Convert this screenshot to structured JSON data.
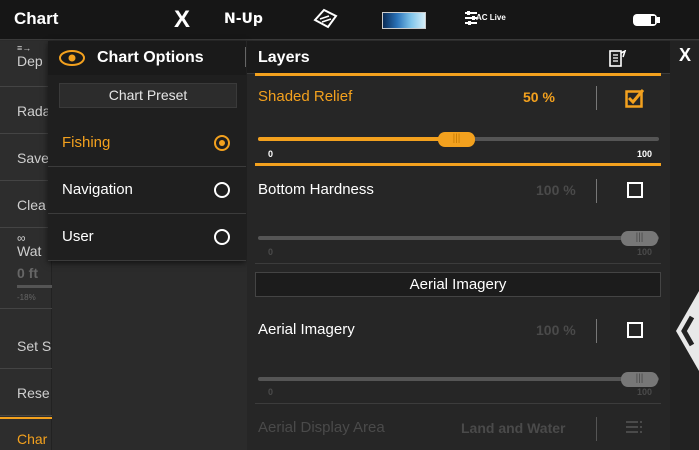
{
  "topbar": {
    "title": "Chart",
    "close_symbol": "X",
    "view_label": "N-Up",
    "aclive_label": "AC Live",
    "icons": [
      "close-icon",
      "sonar-fish-icon",
      "palette-gradient-icon",
      "ac-live-icon",
      "battery-icon"
    ]
  },
  "left_menu": {
    "items": [
      "Dep",
      "Rada",
      "Save",
      "Clea",
      "Wat",
      "0 ft",
      "-18%",
      "Set S",
      "Rese",
      "Char"
    ]
  },
  "chart_options": {
    "title": "Chart Options",
    "preset_label": "Chart Preset",
    "presets": [
      {
        "label": "Fishing",
        "selected": true
      },
      {
        "label": "Navigation",
        "selected": false
      },
      {
        "label": "User",
        "selected": false
      }
    ]
  },
  "layers": {
    "title": "Layers",
    "shaded_relief": {
      "label": "Shaded Relief",
      "value": "50 %",
      "checked": true,
      "level": 0.5,
      "min": "0",
      "max": "100"
    },
    "bottom_hardness": {
      "label": "Bottom Hardness",
      "value": "100 %",
      "checked": false,
      "level": 1.0,
      "min": "0",
      "max": "100"
    },
    "aerial_section": "Aerial Imagery",
    "aerial_imagery": {
      "label": "Aerial Imagery",
      "value": "100 %",
      "checked": false,
      "level": 1.0,
      "min": "0",
      "max": "100"
    },
    "aerial_display_area": {
      "label": "Aerial Display Area",
      "value": "Land and Water"
    }
  },
  "right_strip": {
    "close_symbol": "X"
  },
  "colors": {
    "accent": "#f3a11e",
    "background": "#262626",
    "disabled_text": "#4a4a4a"
  }
}
